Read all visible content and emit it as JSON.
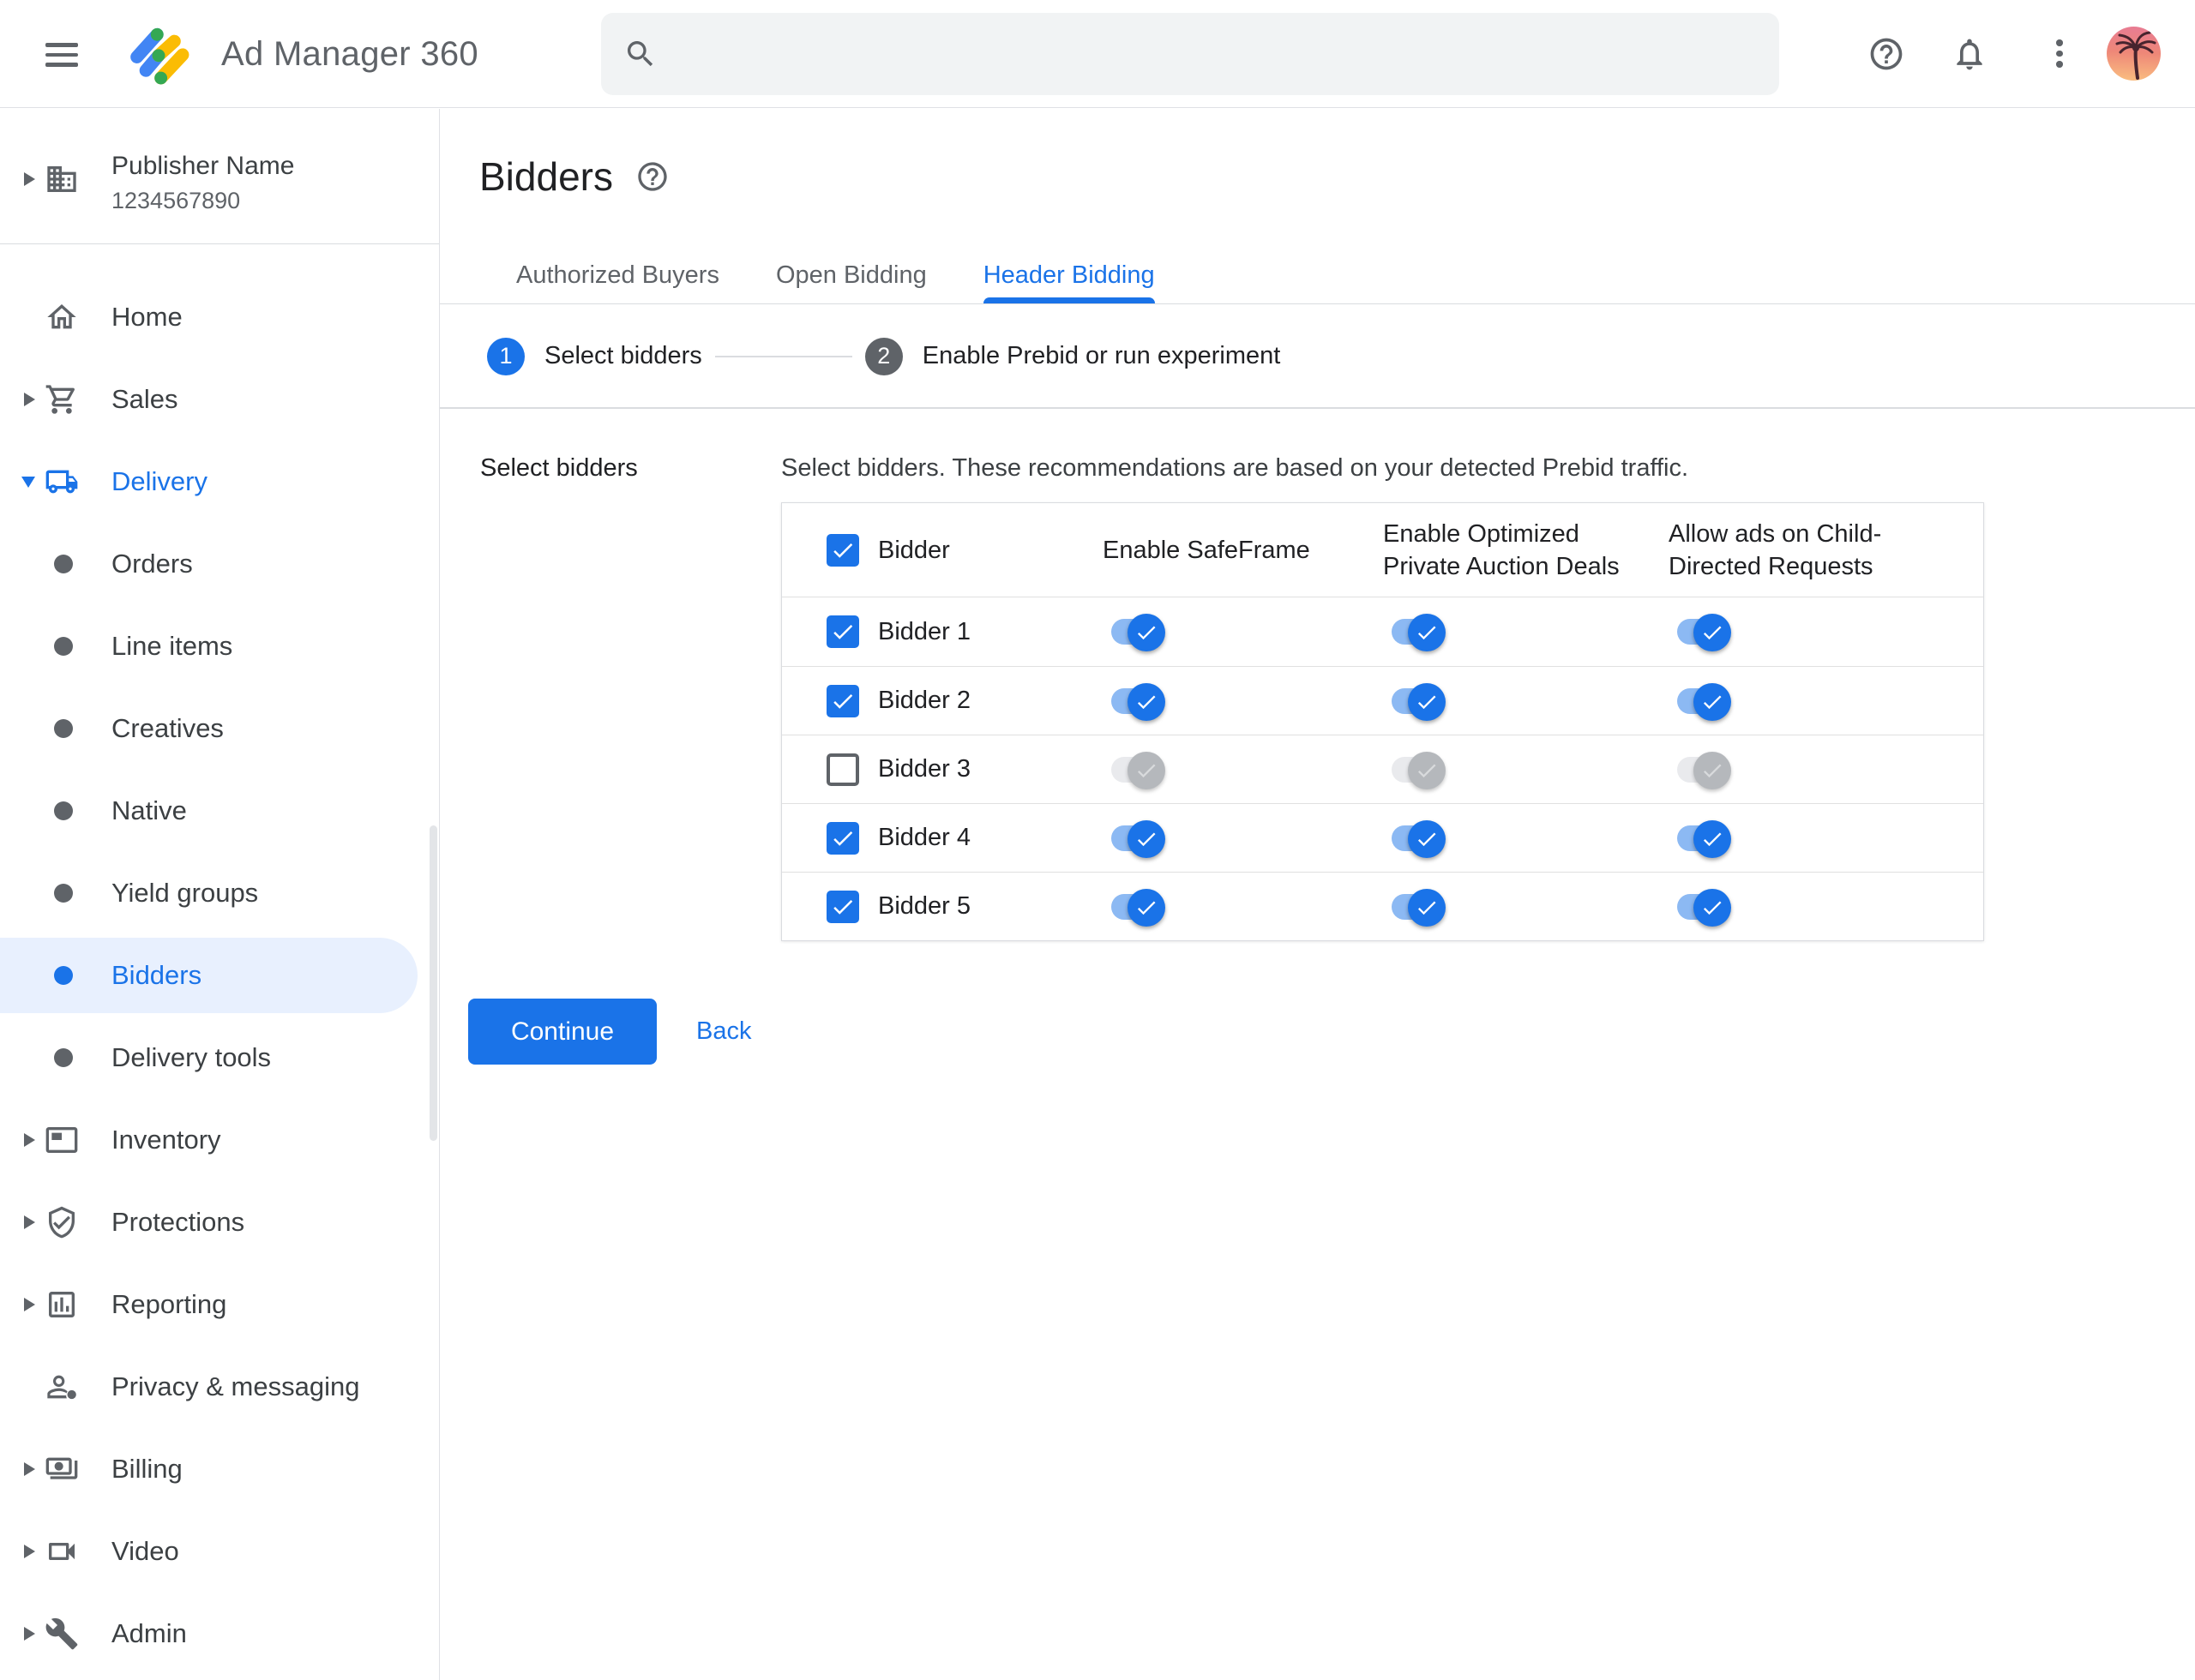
{
  "topbar": {
    "product_name": "Ad Manager 360",
    "search": {
      "value": "",
      "placeholder": ""
    },
    "icons": [
      "menu-icon",
      "ad-manager-logo",
      "search-icon",
      "help-icon",
      "notifications-icon",
      "more-vert-icon",
      "avatar"
    ]
  },
  "sidebar": {
    "publisher": {
      "name": "Publisher Name",
      "id": "1234567890",
      "icon": "building-icon"
    },
    "items": [
      {
        "label": "Home",
        "icon": "home",
        "arrow": "none",
        "level": "top",
        "state": "normal"
      },
      {
        "label": "Sales",
        "icon": "cart",
        "arrow": "right",
        "level": "top",
        "state": "normal"
      },
      {
        "label": "Delivery",
        "icon": "truck",
        "arrow": "down",
        "level": "top",
        "state": "expanded-active"
      },
      {
        "label": "Orders",
        "icon": "bullet",
        "arrow": "none",
        "level": "sub",
        "state": "normal"
      },
      {
        "label": "Line items",
        "icon": "bullet",
        "arrow": "none",
        "level": "sub",
        "state": "normal"
      },
      {
        "label": "Creatives",
        "icon": "bullet",
        "arrow": "none",
        "level": "sub",
        "state": "normal"
      },
      {
        "label": "Native",
        "icon": "bullet",
        "arrow": "none",
        "level": "sub",
        "state": "normal"
      },
      {
        "label": "Yield groups",
        "icon": "bullet",
        "arrow": "none",
        "level": "sub",
        "state": "normal"
      },
      {
        "label": "Bidders",
        "icon": "bullet",
        "arrow": "none",
        "level": "sub",
        "state": "selected"
      },
      {
        "label": "Delivery tools",
        "icon": "bullet",
        "arrow": "none",
        "level": "sub",
        "state": "normal"
      },
      {
        "label": "Inventory",
        "icon": "inventory",
        "arrow": "right",
        "level": "top",
        "state": "normal"
      },
      {
        "label": "Protections",
        "icon": "shield-check",
        "arrow": "right",
        "level": "top",
        "state": "normal"
      },
      {
        "label": "Reporting",
        "icon": "bar-chart",
        "arrow": "right",
        "level": "top",
        "state": "normal"
      },
      {
        "label": "Privacy & messaging",
        "icon": "person-badge",
        "arrow": "none",
        "level": "top",
        "state": "normal"
      },
      {
        "label": "Billing",
        "icon": "banknote",
        "arrow": "right",
        "level": "top",
        "state": "normal"
      },
      {
        "label": "Video",
        "icon": "videocam",
        "arrow": "right",
        "level": "top",
        "state": "normal"
      },
      {
        "label": "Admin",
        "icon": "wrench",
        "arrow": "right",
        "level": "top",
        "state": "normal"
      }
    ]
  },
  "main": {
    "page_title": "Bidders",
    "tabs": [
      {
        "label": "Authorized Buyers",
        "active": false
      },
      {
        "label": "Open Bidding",
        "active": false
      },
      {
        "label": "Header Bidding",
        "active": true
      }
    ],
    "stepper": [
      {
        "number": "1",
        "label": "Select bidders",
        "state": "current"
      },
      {
        "number": "2",
        "label": "Enable Prebid or run experiment",
        "state": "upcoming"
      }
    ],
    "section_label": "Select bidders",
    "description": "Select bidders. These recommendations are based on your detected Prebid traffic.",
    "table": {
      "select_all_checked": true,
      "columns": [
        "Bidder",
        "Enable SafeFrame",
        "Enable Optimized Private Auction Deals",
        "Allow ads on Child-Directed Requests"
      ],
      "rows": [
        {
          "name": "Bidder 1",
          "selected": true,
          "enable_safeframe": true,
          "enable_optimized_private_auction_deals": true,
          "allow_ads_child_directed": true
        },
        {
          "name": "Bidder 2",
          "selected": true,
          "enable_safeframe": true,
          "enable_optimized_private_auction_deals": true,
          "allow_ads_child_directed": true
        },
        {
          "name": "Bidder 3",
          "selected": false,
          "enable_safeframe": true,
          "enable_optimized_private_auction_deals": true,
          "allow_ads_child_directed": true
        },
        {
          "name": "Bidder 4",
          "selected": true,
          "enable_safeframe": true,
          "enable_optimized_private_auction_deals": true,
          "allow_ads_child_directed": true
        },
        {
          "name": "Bidder 5",
          "selected": true,
          "enable_safeframe": true,
          "enable_optimized_private_auction_deals": true,
          "allow_ads_child_directed": true
        }
      ]
    },
    "actions": {
      "continue_label": "Continue",
      "back_label": "Back"
    }
  },
  "colors": {
    "accent": "#1a73e8",
    "selected_nav_bg": "#e8f0fe",
    "toggle_track_on": "#8cb9f3",
    "toggle_thumb_on": "#1a73e8",
    "toggle_track_off": "#e9eaed",
    "toggle_thumb_off": "#b5b8bc",
    "text_primary": "#202124",
    "text_secondary": "#5f6368",
    "border": "#dadce0",
    "search_bg": "#f1f3f4",
    "logo_blue": "#4285f4",
    "logo_yellow": "#fbbc04",
    "logo_green": "#34a853"
  }
}
